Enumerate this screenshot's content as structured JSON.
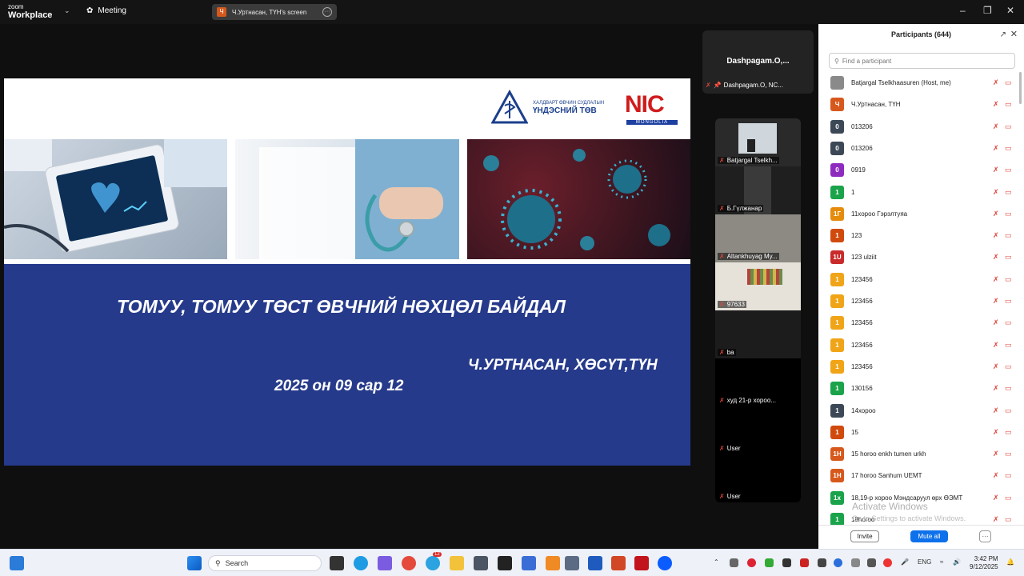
{
  "titlebar": {
    "brand_top": "zoom",
    "brand": "Workplace",
    "meeting_label": "Meeting",
    "share_avatar": "Ч",
    "share_label": "Ч.Уртнасан, ТҮН's screen"
  },
  "slide": {
    "logo_line1": "ХАЛДВАРТ ӨВЧИН СУДЛАЛЫН",
    "logo_line2": "ҮНДЭСНИЙ ТӨВ",
    "nic_letters": "NIC",
    "nic_sub": "MONGOLIA",
    "title": "ТОМУУ, ТОМУУ ТӨСТ ӨВЧНИЙ НӨХЦӨЛ БАЙДАЛ",
    "author": "Ч.УРТНАСАН, ХӨСҮТ,ТҮН",
    "date": "2025  он 09 сар  12"
  },
  "pinned": {
    "name": "Dashpagam.O,...",
    "label": "Dashpagam.O, NC..."
  },
  "gallery": [
    {
      "label": "Batjargal Tselkh..."
    },
    {
      "label": "Б.Гүлжанар"
    },
    {
      "label": "Altankhuyag My..."
    },
    {
      "label": "97633"
    },
    {
      "label": "ba"
    },
    {
      "label": "худ 21-р хороо..."
    },
    {
      "label": "User"
    },
    {
      "label": "User"
    }
  ],
  "panel": {
    "title": "Participants (644)",
    "search_placeholder": "Find a participant",
    "invite": "Invite",
    "mute_all": "Mute all",
    "more": "···",
    "activate1": "Activate Windows",
    "activate2": "Go to Settings to activate Windows.",
    "participants": [
      {
        "avatar": "",
        "name": "Batjargal Tselkhaasuren (Host, me)",
        "color": "#8a8a8a"
      },
      {
        "avatar": "Ч",
        "name": "Ч.Уртнасан, ТҮН",
        "color": "#d7581c"
      },
      {
        "avatar": "0",
        "name": "013206",
        "color": "#3d4857"
      },
      {
        "avatar": "0",
        "name": "013206",
        "color": "#3d4857"
      },
      {
        "avatar": "0",
        "name": "0919",
        "color": "#8e2bbf"
      },
      {
        "avatar": "1",
        "name": "1",
        "color": "#1aa34a"
      },
      {
        "avatar": "1Г",
        "name": "11хороо Гэрэлтуяа",
        "color": "#e58c0d"
      },
      {
        "avatar": "1",
        "name": "123",
        "color": "#d04a0e"
      },
      {
        "avatar": "1U",
        "name": "123 ulziit",
        "color": "#c92a2a"
      },
      {
        "avatar": "1",
        "name": "123456",
        "color": "#f0a417"
      },
      {
        "avatar": "1",
        "name": "123456",
        "color": "#f0a417"
      },
      {
        "avatar": "1",
        "name": "123456",
        "color": "#f0a417"
      },
      {
        "avatar": "1",
        "name": "123456",
        "color": "#f0a417"
      },
      {
        "avatar": "1",
        "name": "123456",
        "color": "#f0a417"
      },
      {
        "avatar": "1",
        "name": "130156",
        "color": "#1aa34a"
      },
      {
        "avatar": "1",
        "name": "14хороо",
        "color": "#3d4857"
      },
      {
        "avatar": "1",
        "name": "15",
        "color": "#d04a0e"
      },
      {
        "avatar": "1H",
        "name": "15 horoo enkh tumen urkh",
        "color": "#d7581c"
      },
      {
        "avatar": "1H",
        "name": "17 horoo Sanhum UEMT",
        "color": "#d7581c"
      },
      {
        "avatar": "1x",
        "name": "18,19-р хороо  Мэндсаруул өрх ӨЭМТ",
        "color": "#1aa34a"
      },
      {
        "avatar": "1",
        "name": "18horoo",
        "color": "#1aa34a"
      }
    ]
  },
  "taskbar": {
    "search": "Search",
    "lang": "ENG",
    "time": "3:42 PM",
    "date": "9/12/2025",
    "badge": "12"
  }
}
